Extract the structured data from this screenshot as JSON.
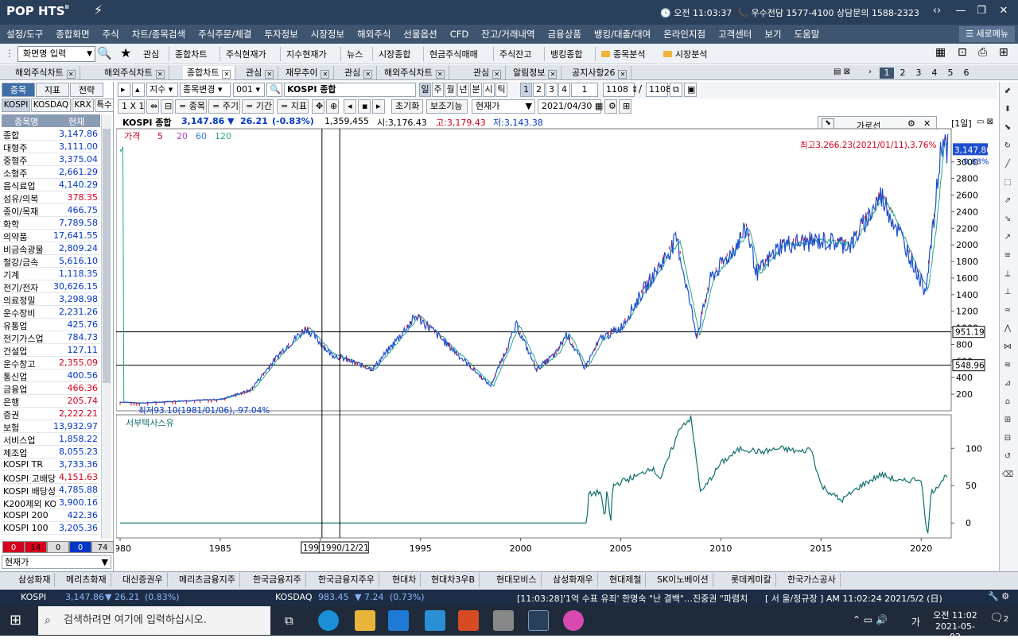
{
  "app": {
    "logo": "POP HTS",
    "logo_sup": "II",
    "clock": "오전 11:03:37",
    "broker": "우수전담 1577-4100 상담문의 1588-2323"
  },
  "menu": [
    "설정/도구",
    "종합화면",
    "주식",
    "차트/종목검색",
    "주식주문/체결",
    "투자정보",
    "시장정보",
    "해외주식",
    "선물옵션",
    "CFD",
    "잔고/거래내역",
    "금융상품",
    "뱅킹/대출/대여",
    "온라인지점",
    "고객센터",
    "보기",
    "도움말"
  ],
  "new_menu": "새로메뉴",
  "toolbar": {
    "screen_input": "화면명 입력",
    "items": [
      "관심",
      "종합차트",
      "주식현재가",
      "지수현재가",
      "뉴스",
      "시장종합",
      "현금주식매매",
      "주식잔고",
      "뱅킹종합"
    ],
    "folders": [
      "종목분석",
      "시장분석"
    ]
  },
  "tabs": [
    "해외주식차트",
    "해외주식차트",
    "종합차트",
    "관심",
    "재무추이",
    "관심",
    "해외주식차트",
    "관심",
    "알림정보",
    "공지사항26"
  ],
  "pages": [
    "1",
    "2",
    "3",
    "4",
    "5",
    "6"
  ],
  "left": {
    "tabs": [
      "종목",
      "지표",
      "전략"
    ],
    "subtabs": [
      "KOSPI",
      "KOSDAQ",
      "KRX",
      "특수"
    ],
    "header": [
      "종목명",
      "현재"
    ],
    "rows": [
      {
        "n": "종합",
        "v": "3,147.86",
        "c": "blue"
      },
      {
        "n": "대형주",
        "v": "3,111.00",
        "c": "blue"
      },
      {
        "n": "중형주",
        "v": "3,375.04",
        "c": "blue"
      },
      {
        "n": "소형주",
        "v": "2,661.29",
        "c": "blue"
      },
      {
        "n": "음식료업",
        "v": "4,140.29",
        "c": "blue"
      },
      {
        "n": "섬유/의복",
        "v": "378.35",
        "c": "red"
      },
      {
        "n": "종이/목재",
        "v": "466.75",
        "c": "blue"
      },
      {
        "n": "화학",
        "v": "7,789.58",
        "c": "blue"
      },
      {
        "n": "의약품",
        "v": "17,641.55",
        "c": "blue"
      },
      {
        "n": "비금속광물",
        "v": "2,809.24",
        "c": "blue"
      },
      {
        "n": "철강/금속",
        "v": "5,616.10",
        "c": "blue"
      },
      {
        "n": "기계",
        "v": "1,118.35",
        "c": "blue"
      },
      {
        "n": "전기/전자",
        "v": "30,626.15",
        "c": "blue"
      },
      {
        "n": "의료정밀",
        "v": "3,298.98",
        "c": "blue"
      },
      {
        "n": "운수장비",
        "v": "2,231.26",
        "c": "blue"
      },
      {
        "n": "유통업",
        "v": "425.76",
        "c": "blue"
      },
      {
        "n": "전기가스업",
        "v": "784.73",
        "c": "blue"
      },
      {
        "n": "건설업",
        "v": "127.11",
        "c": "blue"
      },
      {
        "n": "운수창고",
        "v": "2,355.09",
        "c": "red"
      },
      {
        "n": "통신업",
        "v": "400.56",
        "c": "blue"
      },
      {
        "n": "금융업",
        "v": "466.36",
        "c": "red"
      },
      {
        "n": "은행",
        "v": "205.74",
        "c": "red"
      },
      {
        "n": "증권",
        "v": "2,222.21",
        "c": "red"
      },
      {
        "n": "보험",
        "v": "13,932.97",
        "c": "blue"
      },
      {
        "n": "서비스업",
        "v": "1,858.22",
        "c": "blue"
      },
      {
        "n": "제조업",
        "v": "8,055.23",
        "c": "blue"
      },
      {
        "n": "KOSPI TR",
        "v": "3,733.36",
        "c": "blue"
      },
      {
        "n": "KOSPI 고배당",
        "v": "4,151.63",
        "c": "red"
      },
      {
        "n": "KOSPI 배당성",
        "v": "4,785.88",
        "c": "blue"
      },
      {
        "n": "K200제외 KO",
        "v": "3,900.16",
        "c": "blue"
      },
      {
        "n": "KOSPI 200",
        "v": "422.36",
        "c": "blue"
      },
      {
        "n": "KOSPI 100",
        "v": "3,205.36",
        "c": "blue"
      }
    ],
    "counts": [
      "0",
      "14",
      "0",
      "0",
      "74"
    ],
    "bottom_select": "현재가"
  },
  "chart_ctrl": {
    "kind": "지수",
    "change": "종목변경",
    "code": "001",
    "name": "KOSPI 종합",
    "periods": [
      "일",
      "주",
      "월",
      "년",
      "분",
      "시",
      "틱"
    ],
    "nums": [
      "1",
      "2",
      "3",
      "4",
      "1"
    ],
    "count1": "1108",
    "count2": "1108",
    "row2": [
      "1 X 1",
      "= 종목",
      "= 주기",
      "= 기간",
      "= 지표"
    ],
    "init": "초기화",
    "aux": "보조기능",
    "price_sel": "현재가",
    "date": "2021/04/30"
  },
  "info": {
    "name": "KOSPI 종합",
    "price": "3,147.86",
    "arrow": "▼",
    "change": "26.21",
    "pct": "(-0.83%)",
    "volume": "1,359,455",
    "open": "시:3,176.43",
    "high": "고:3,179.43",
    "low": "저:3,143.38"
  },
  "legend": {
    "price": "가격",
    "ma": [
      "5",
      "20",
      "60",
      "120"
    ],
    "sub": "서부텍사스유"
  },
  "garoseon": "가로선",
  "day_label": "[1일]",
  "annotations": {
    "max": "최고3,266.23(2021/01/11),3.76%",
    "min": "최저93.10(1981/01/06),-97.04%",
    "cur_price": "3,147.86",
    "cur_pct": "-0.83%",
    "hline1": "951.19",
    "hline2": "548.96",
    "cursor1": "1990",
    "cursor2": "1990/12/21"
  },
  "chart_data": [
    {
      "type": "line",
      "title": "KOSPI 종합",
      "series": [
        {
          "name": "가격",
          "points": [
            [
              1980.0,
              106
            ],
            [
              1981.0,
              93
            ],
            [
              1983.0,
              118
            ],
            [
              1985.0,
              138
            ],
            [
              1986.5,
              250
            ],
            [
              1988.0,
              700
            ],
            [
              1989.3,
              1000
            ],
            [
              1990.5,
              690
            ],
            [
              1991.5,
              600
            ],
            [
              1992.6,
              500
            ],
            [
              1994.8,
              1145
            ],
            [
              1996.0,
              880
            ],
            [
              1998.5,
              300
            ],
            [
              1999.8,
              1030
            ],
            [
              2000.8,
              500
            ],
            [
              2001.8,
              700
            ],
            [
              2002.3,
              930
            ],
            [
              2003.2,
              520
            ],
            [
              2004.0,
              870
            ],
            [
              2005.0,
              1000
            ],
            [
              2006.0,
              1400
            ],
            [
              2007.8,
              2064
            ],
            [
              2008.8,
              900
            ],
            [
              2009.5,
              1600
            ],
            [
              2010.5,
              1900
            ],
            [
              2011.3,
              2200
            ],
            [
              2011.8,
              1650
            ],
            [
              2013.0,
              2000
            ],
            [
              2015.0,
              2050
            ],
            [
              2016.5,
              2000
            ],
            [
              2017.5,
              2400
            ],
            [
              2018.0,
              2600
            ],
            [
              2019.0,
              2100
            ],
            [
              2020.2,
              1450
            ],
            [
              2020.6,
              2200
            ],
            [
              2021.03,
              3266
            ],
            [
              2021.33,
              3147.86
            ]
          ]
        }
      ],
      "xlim": [
        1979.8,
        2021.5
      ],
      "ylim": [
        0,
        3400
      ],
      "yticks": [
        200,
        400,
        600,
        800,
        1000,
        1200,
        1400,
        1600,
        1800,
        2000,
        2200,
        2400,
        2600,
        2800,
        3000
      ],
      "xticks": [
        1980,
        1985,
        1990,
        1995,
        2000,
        2005,
        2010,
        2015,
        2020
      ],
      "hlines": [
        951.19,
        548.96
      ]
    },
    {
      "type": "line",
      "title": "서부텍사스유",
      "series": [
        {
          "name": "서부텍사스유",
          "points": [
            [
              1980.0,
              0
            ],
            [
              2003.3,
              0
            ],
            [
              2003.4,
              38
            ],
            [
              2004.0,
              42
            ],
            [
              2004.2,
              0
            ],
            [
              2004.3,
              45
            ],
            [
              2004.5,
              0
            ],
            [
              2004.6,
              50
            ],
            [
              2005.0,
              55
            ],
            [
              2006.0,
              65
            ],
            [
              2006.5,
              75
            ],
            [
              2007.0,
              60
            ],
            [
              2008.0,
              130
            ],
            [
              2008.5,
              140
            ],
            [
              2009.0,
              40
            ],
            [
              2010.0,
              80
            ],
            [
              2011.0,
              100
            ],
            [
              2012.0,
              95
            ],
            [
              2013.0,
              100
            ],
            [
              2014.0,
              95
            ],
            [
              2014.5,
              100
            ],
            [
              2015.0,
              50
            ],
            [
              2016.0,
              30
            ],
            [
              2017.0,
              50
            ],
            [
              2018.0,
              65
            ],
            [
              2019.0,
              55
            ],
            [
              2020.0,
              60
            ],
            [
              2020.3,
              -20
            ],
            [
              2020.5,
              40
            ],
            [
              2021.3,
              65
            ]
          ]
        }
      ],
      "ylim": [
        -20,
        145
      ],
      "yticks": [
        0,
        50,
        100
      ]
    }
  ],
  "bottom_tabs": [
    "삼성화재",
    "메리츠화재",
    "대신증권우",
    "메리츠금융지주",
    "한국금융지주",
    "한국금융지주우",
    "현대차",
    "현대차3우B",
    "현대모비스",
    "삼성화재우",
    "현대제철",
    "SK이노베이션",
    "롯데케미칼",
    "한국가스공사"
  ],
  "ticker": {
    "kospi": "KOSPI",
    "kospi_val": "3,147.86",
    "kospi_chg": "26.21",
    "kospi_pct": "(0.83%)",
    "kosdaq": "KOSDAQ",
    "kosdaq_val": "983.45",
    "kosdaq_chg": "7.24",
    "kosdaq_pct": "(0.73%)",
    "news": "[11:03:28]'1억 수표 유죄' 한명숙 \"난 결백\"…진중권 \"파렴치",
    "time": "[ 서   울/정규장 ] AM 11:02:24  2021/5/2 (日)"
  },
  "taskbar": {
    "search": "검색하려면 여기에 입력하십시오.",
    "time": "오전 11:02",
    "date": "2021-05-02",
    "lang": "가",
    "notif": "2"
  }
}
